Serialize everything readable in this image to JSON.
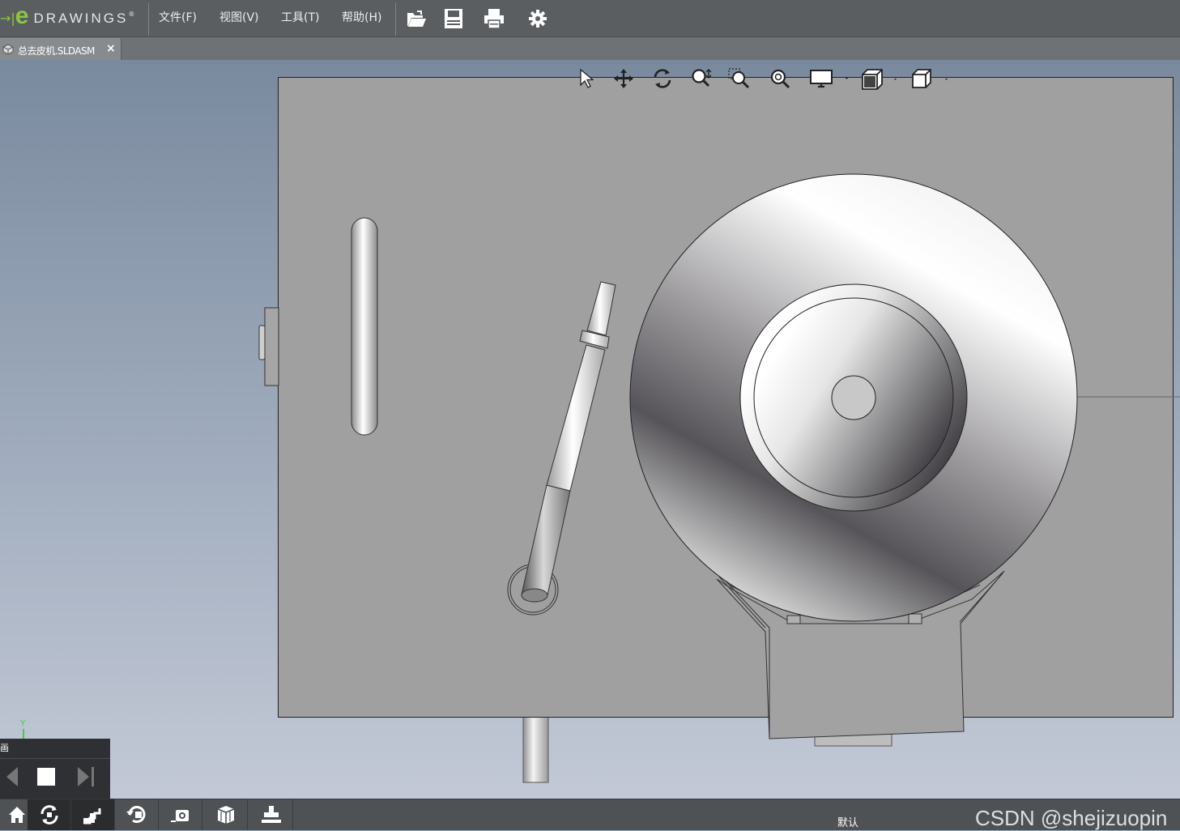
{
  "app": {
    "logo_arrow": "→|",
    "logo_e": "e",
    "logo_text": "DRAWINGS",
    "logo_mark": "®"
  },
  "menu": {
    "file": "文件(F)",
    "view": "视图(V)",
    "tools": "工具(T)",
    "help": "帮助(H)"
  },
  "toolbar": {
    "icons": [
      "open-icon",
      "save-icon",
      "print-icon",
      "settings-icon"
    ]
  },
  "tab": {
    "label": "总去皮机.SLDASM",
    "close": "×"
  },
  "view_toolbar": {
    "icons": [
      "select-icon",
      "pan-icon",
      "rotate-icon",
      "zoom-icon",
      "zoom-to-area-icon",
      "zoom-to-fit-icon",
      "display-style-icon",
      "view-orientation-icon",
      "standard-views-icon"
    ]
  },
  "triad": {
    "y_label": "Y"
  },
  "animation": {
    "title": "画",
    "buttons": [
      "step-back-icon",
      "stop-icon",
      "step-forward-icon"
    ]
  },
  "bottom_bar": {
    "buttons": [
      "home-icon",
      "reset-icon",
      "steps-icon",
      "rotate-view-icon",
      "camera-icon",
      "components-icon",
      "stamp-icon"
    ],
    "config_label": "默认"
  },
  "watermark": "CSDN @shejizuopin",
  "colors": {
    "accent_green": "#8cc63f",
    "topbar": "#5a5e61",
    "part_face": "#a0a0a0"
  }
}
